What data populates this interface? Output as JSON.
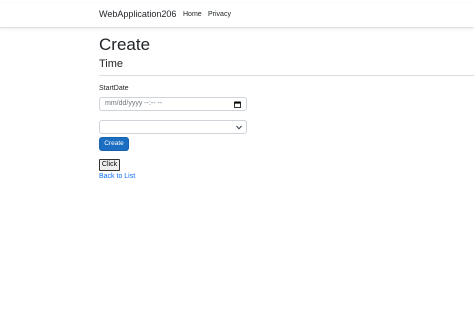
{
  "navbar": {
    "brand": "WebApplication206",
    "links": [
      {
        "label": "Home"
      },
      {
        "label": "Privacy"
      }
    ]
  },
  "main": {
    "title": "Create",
    "subtitle": "Time",
    "form": {
      "start_date_label": "StartDate",
      "start_date_placeholder": "mm/dd/yyyy --:-- --",
      "select_value": "",
      "create_label": "Create"
    },
    "click_label": "Click",
    "back_link": "Back to List"
  },
  "colors": {
    "primary": "#1b6ec2",
    "link": "#0d6efd"
  }
}
